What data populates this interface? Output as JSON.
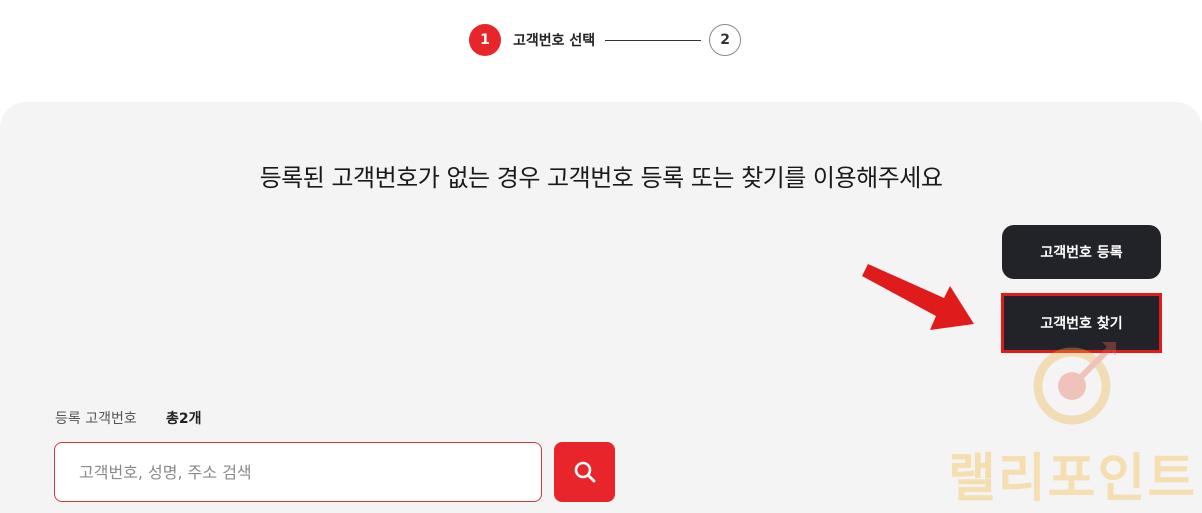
{
  "stepper": {
    "step1_number": "1",
    "step1_label": "고객번호 선택",
    "step2_number": "2"
  },
  "headline": "등록된 고객번호가 없는 경우 고객번호 등록 또는 찾기를 이용해주세요",
  "buttons": {
    "register_label": "고객번호 등록",
    "find_label": "고객번호 찾기"
  },
  "registered": {
    "label": "등록 고객번호",
    "count": "총2개"
  },
  "search": {
    "placeholder": "고객번호, 성명, 주소 검색",
    "value": ""
  },
  "watermark": {
    "text": "랠리포인트"
  },
  "colors": {
    "accent": "#e8252a",
    "dark_button": "#222328",
    "panel_bg": "#f4f4f5",
    "arrow": "#e01b1b"
  },
  "icons": {
    "search_button": "search-icon",
    "annotation": "red-arrow-icon",
    "watermark_logo": "target-logo-icon"
  }
}
